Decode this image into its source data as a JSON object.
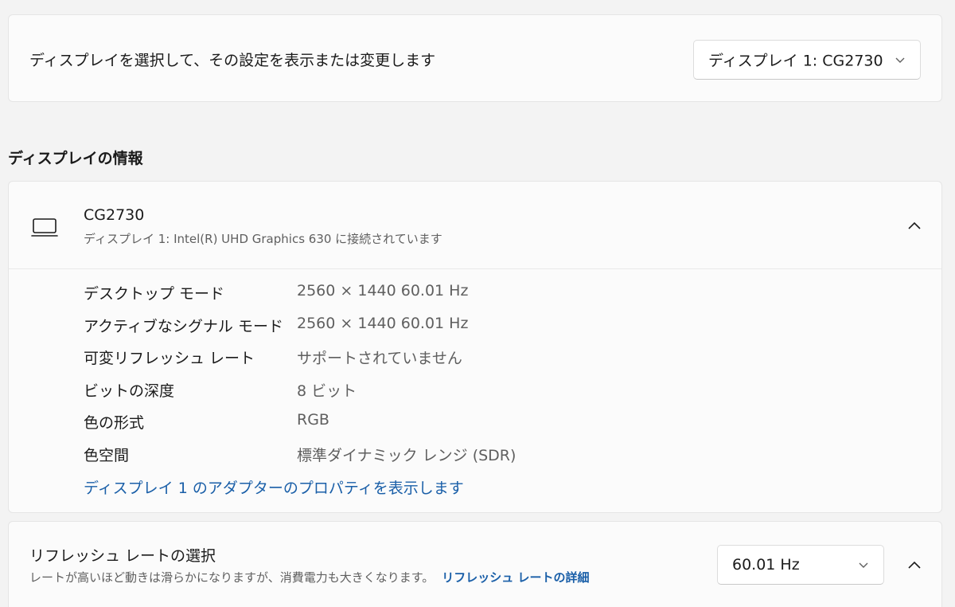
{
  "select_display": {
    "label": "ディスプレイを選択して、その設定を表示または変更します",
    "dropdown_value": "ディスプレイ 1: CG2730"
  },
  "display_info": {
    "heading": "ディスプレイの情報",
    "name": "CG2730",
    "subtitle": "ディスプレイ 1: Intel(R) UHD Graphics 630 に接続されています",
    "icon": "monitor-icon",
    "specs": [
      {
        "key": "デスクトップ モード",
        "value": "2560 × 1440 60.01 Hz"
      },
      {
        "key": "アクティブなシグナル モード",
        "value": "2560 × 1440 60.01 Hz"
      },
      {
        "key": "可変リフレッシュ レート",
        "value": "サポートされていません"
      },
      {
        "key": "ビットの深度",
        "value": "8 ビット"
      },
      {
        "key": "色の形式",
        "value": "RGB"
      },
      {
        "key": "色空間",
        "value": "標準ダイナミック レンジ (SDR)"
      }
    ],
    "adapter_link": "ディスプレイ 1 のアダプターのプロパティを表示します"
  },
  "refresh_rate": {
    "title": "リフレッシュ レートの選択",
    "description": "レートが高いほど動きは滑らかになりますが、消費電力も大きくなります。",
    "details_link": "リフレッシュ レートの詳細",
    "dropdown_value": "60.01 Hz"
  },
  "colors": {
    "link": "#1a5fa8",
    "background": "#f3f3f3",
    "card": "#fbfbfb"
  }
}
